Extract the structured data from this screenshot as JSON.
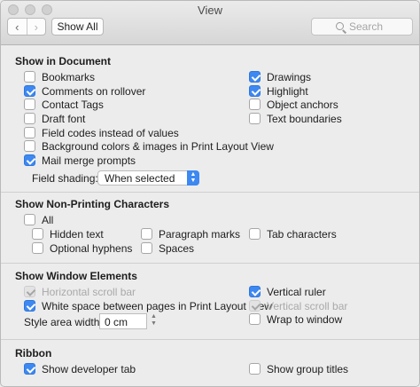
{
  "window": {
    "title": "View"
  },
  "toolbar": {
    "back_glyph": "‹",
    "forward_glyph": "›",
    "show_all_label": "Show All",
    "search_placeholder": "Search"
  },
  "sections": {
    "show_in_document": "Show in Document",
    "non_printing": "Show Non-Printing Characters",
    "window_elements": "Show Window Elements",
    "ribbon": "Ribbon"
  },
  "show_in_document": {
    "left": [
      {
        "label": "Bookmarks",
        "checked": false
      },
      {
        "label": "Comments on rollover",
        "checked": true
      },
      {
        "label": "Contact Tags",
        "checked": false
      },
      {
        "label": "Draft font",
        "checked": false
      },
      {
        "label": "Field codes instead of values",
        "checked": false
      },
      {
        "label": "Background colors & images in Print Layout View",
        "checked": false
      },
      {
        "label": "Mail merge prompts",
        "checked": true
      }
    ],
    "right": [
      {
        "label": "Drawings",
        "checked": true
      },
      {
        "label": "Highlight",
        "checked": true
      },
      {
        "label": "Object anchors",
        "checked": false
      },
      {
        "label": "Text boundaries",
        "checked": false
      }
    ],
    "field_shading_label": "Field shading:",
    "field_shading_value": "When selected"
  },
  "non_printing": {
    "all": {
      "label": "All",
      "checked": false
    },
    "items": [
      {
        "label": "Hidden text",
        "checked": false
      },
      {
        "label": "Paragraph marks",
        "checked": false
      },
      {
        "label": "Tab characters",
        "checked": false
      },
      {
        "label": "Optional hyphens",
        "checked": false
      },
      {
        "label": "Spaces",
        "checked": false
      }
    ]
  },
  "window_elements": {
    "left": [
      {
        "label": "Horizontal scroll bar",
        "checked": true,
        "disabled": true
      },
      {
        "label": "White space between pages in Print Layout View",
        "checked": true,
        "disabled": false
      }
    ],
    "right": [
      {
        "label": "Vertical ruler",
        "checked": true,
        "disabled": false
      },
      {
        "label": "Vertical scroll bar",
        "checked": true,
        "disabled": true
      },
      {
        "label": "Wrap to window",
        "checked": false,
        "disabled": false
      }
    ],
    "style_area_label": "Style area width:",
    "style_area_value": "0 cm"
  },
  "ribbon": {
    "developer_tab": {
      "label": "Show developer tab",
      "checked": true
    },
    "group_titles": {
      "label": "Show group titles",
      "checked": false
    }
  },
  "colors": {
    "accent": "#3d88f1",
    "background": "#ececec"
  }
}
